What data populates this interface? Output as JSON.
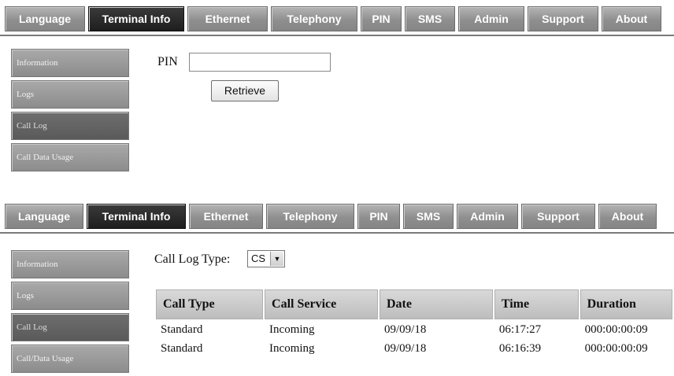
{
  "tabs": [
    "Language",
    "Terminal Info",
    "Ethernet",
    "Telephony",
    "PIN",
    "SMS",
    "Admin",
    "Support",
    "About"
  ],
  "active_tab": "Terminal Info",
  "sidebar_top": [
    "Information",
    "Logs",
    "Call Log",
    "Call Data Usage"
  ],
  "sidebar_bottom": [
    "Information",
    "Logs",
    "Call Log",
    "Call/Data Usage"
  ],
  "pin_screen": {
    "label": "PIN",
    "value": "",
    "button": "Retrieve"
  },
  "call_log_screen": {
    "label": "Call Log Type:",
    "selected": "CS",
    "columns": [
      "Call Type",
      "Call Service",
      "Date",
      "Time",
      "Duration"
    ],
    "rows": [
      [
        "Standard",
        "Incoming",
        "09/09/18",
        "06:17:27",
        "000:00:00:09"
      ],
      [
        "Standard",
        "Incoming",
        "09/09/18",
        "06:16:39",
        "000:00:00:09"
      ]
    ]
  }
}
